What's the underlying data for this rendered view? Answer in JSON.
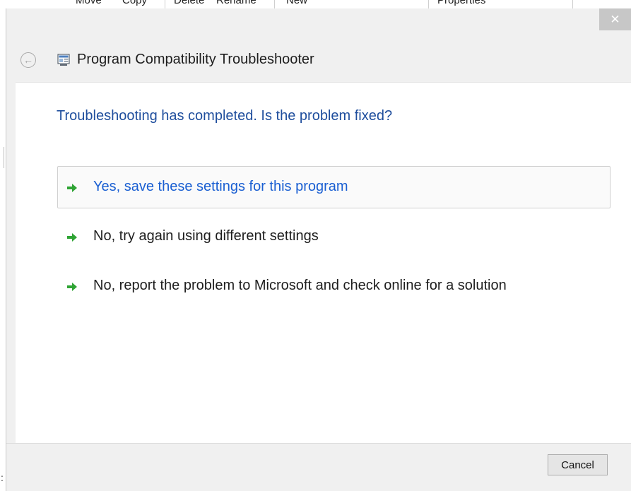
{
  "background_window": {
    "toolbar_labels": [
      "Move",
      "Copy",
      "Delete",
      "Rename",
      "New",
      "Properties"
    ]
  },
  "window": {
    "close_symbol": "✕",
    "title": "Program Compatibility Troubleshooter",
    "back_symbol": "←"
  },
  "content": {
    "heading": "Troubleshooting has completed.  Is the problem fixed?",
    "options": [
      {
        "label": "Yes, save these settings for this program",
        "selected": true
      },
      {
        "label": "No, try again using different settings",
        "selected": false
      },
      {
        "label": "No, report the problem to Microsoft and check online for a solution",
        "selected": false
      }
    ]
  },
  "footer": {
    "cancel_label": "Cancel"
  },
  "icons": {
    "back": "back-arrow-icon",
    "app": "troubleshooter-app-icon",
    "option_arrow": "green-arrow-icon",
    "close": "close-icon"
  },
  "colors": {
    "heading": "#1f4e9d",
    "selected_option": "#1a5fd2",
    "arrow_green": "#2fa434",
    "close_bg": "#c7c7c7"
  }
}
